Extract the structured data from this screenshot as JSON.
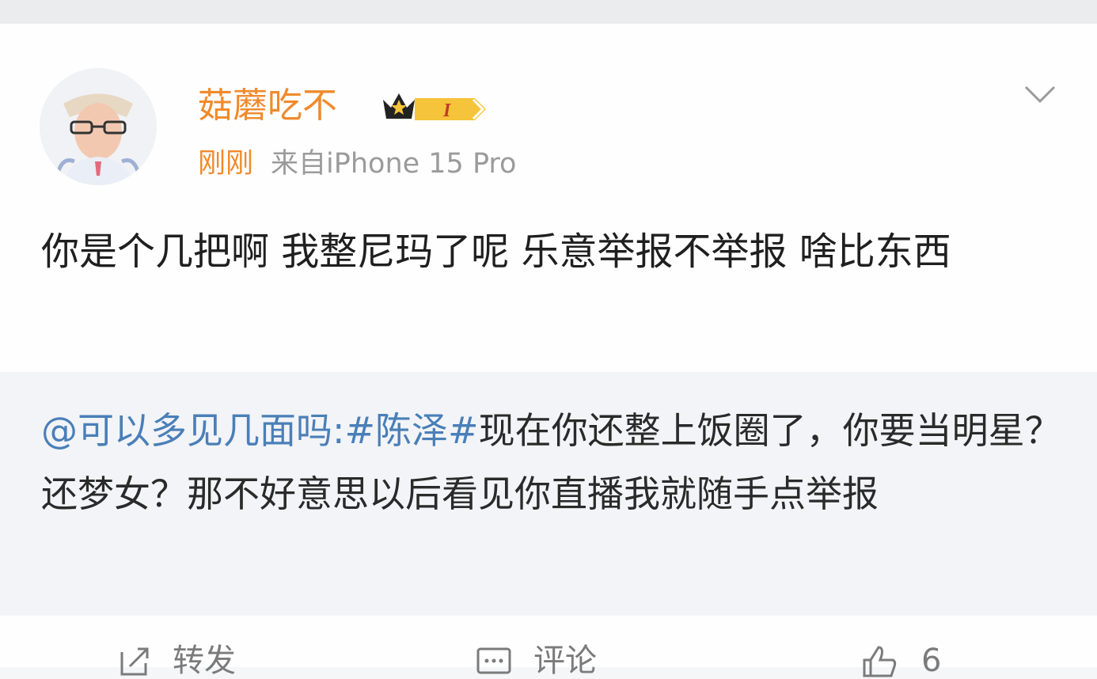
{
  "post": {
    "username": "菇蘑吃不",
    "badge_level": "I",
    "time": "刚刚",
    "source": "来自iPhone 15 Pro",
    "text": "你是个几把啊 我整尼玛了呢 乐意举报不举报 啥比东西"
  },
  "quote": {
    "mention": "@可以多见几面吗",
    "topic": ":#陈泽#",
    "text": "现在你还整上饭圈了，你要当明星？还梦女？那不好意思以后看见你直播我就随手点举报"
  },
  "actions": {
    "repost_label": "转发",
    "comment_label": "评论",
    "like_count": "6"
  },
  "colors": {
    "username": "#f08a2c",
    "mention": "#4a7fb8",
    "quote_bg": "#f3f4f7"
  },
  "icons": [
    "avatar",
    "vip-crown-icon",
    "chevron-down-icon",
    "repost-icon",
    "comment-icon",
    "like-icon"
  ]
}
